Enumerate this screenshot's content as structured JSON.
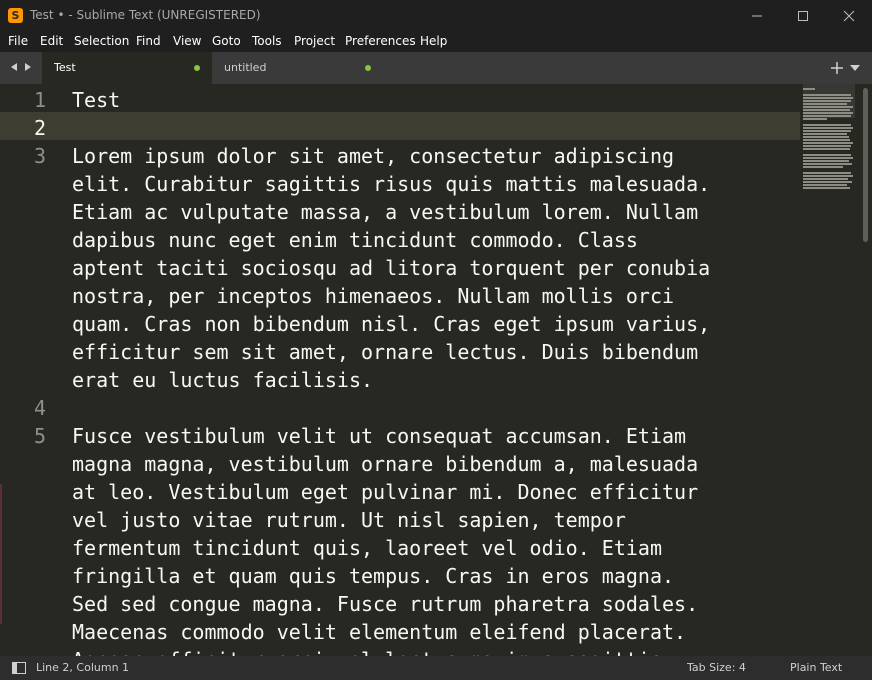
{
  "window": {
    "title": "Test • - Sublime Text (UNREGISTERED)",
    "app_icon_letter": "S",
    "app_icon_color": "#ff9800"
  },
  "menu": [
    "File",
    "Edit",
    "Selection",
    "Find",
    "View",
    "Goto",
    "Tools",
    "Project",
    "Preferences",
    "Help"
  ],
  "tabs": [
    {
      "label": "Test",
      "active": true,
      "modified": true
    },
    {
      "label": "untitled",
      "active": false,
      "modified": true
    }
  ],
  "editor": {
    "theme_background": "#272822",
    "current_line_number": 2,
    "line_numbers": [
      "1",
      "2",
      "3",
      "4",
      "5"
    ],
    "lines": {
      "l1": "Test",
      "l3": [
        "Lorem ipsum dolor sit amet, consectetur adipiscing",
        "elit. Curabitur sagittis risus quis mattis malesuada.",
        "Etiam ac vulputate massa, a vestibulum lorem. Nullam",
        "dapibus nunc eget enim tincidunt commodo. Class",
        "aptent taciti sociosqu ad litora torquent per conubia",
        "nostra, per inceptos himenaeos. Nullam mollis orci",
        "quam. Cras non bibendum nisl. Cras eget ipsum varius,",
        "efficitur sem sit amet, ornare lectus. Duis bibendum",
        "erat eu luctus facilisis."
      ],
      "l5": [
        "Fusce vestibulum velit ut consequat accumsan. Etiam",
        "magna magna, vestibulum ornare bibendum a, malesuada",
        "at leo. Vestibulum eget pulvinar mi. Donec efficitur",
        "vel justo vitae rutrum. Ut nisl sapien, tempor",
        "fermentum tincidunt quis, laoreet vel odio. Etiam",
        "fringilla et quam quis tempus. Cras in eros magna.",
        "Sed sed congue magna. Fusce rutrum pharetra sodales.",
        "Maecenas commodo velit elementum eleifend placerat.",
        "Aenean efficitur orci vel lectus maximus sagittis."
      ]
    }
  },
  "status": {
    "position": "Line 2, Column 1",
    "tab_size": "Tab Size: 4",
    "syntax": "Plain Text"
  }
}
